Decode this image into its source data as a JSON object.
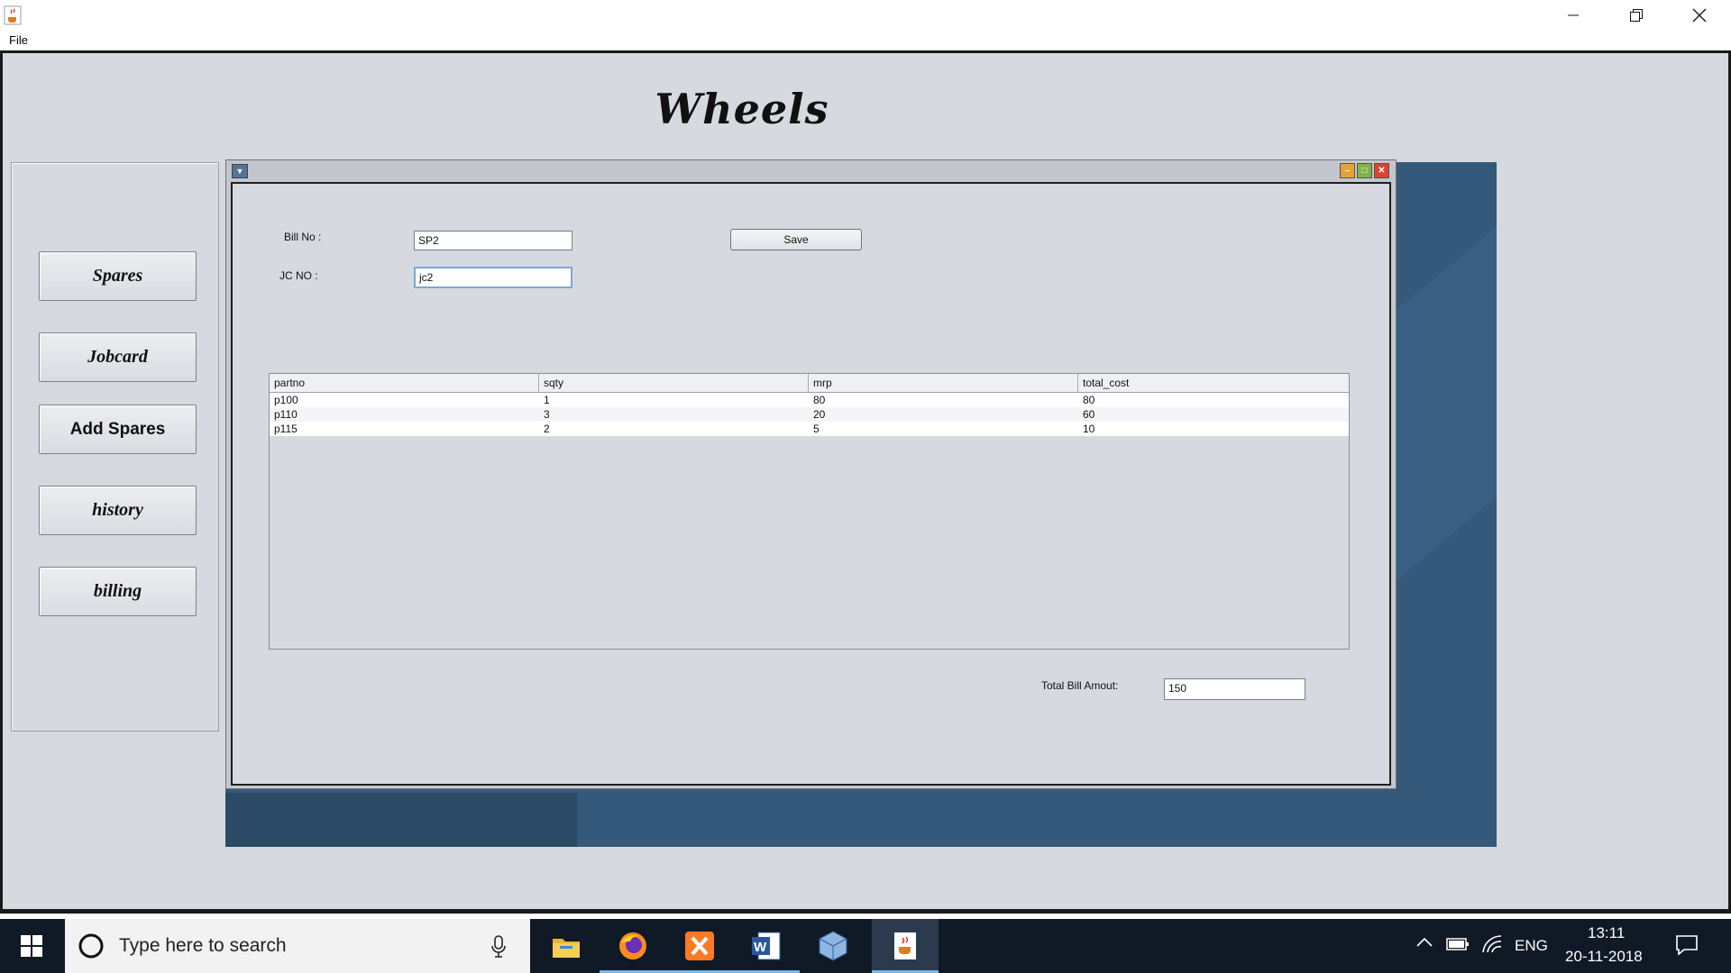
{
  "window": {
    "app_icon": "java-cup-icon",
    "controls": [
      "minimize-icon",
      "restore-icon",
      "close-icon"
    ]
  },
  "menubar": {
    "file_label": "File"
  },
  "app": {
    "title": "Wheels"
  },
  "sidebar": {
    "items": [
      {
        "label": "Spares"
      },
      {
        "label": "Jobcard"
      },
      {
        "label": "Add Spares"
      },
      {
        "label": "history"
      },
      {
        "label": "billing"
      }
    ]
  },
  "internal_frame": {
    "bill_no_label": "Bill No :",
    "bill_no_value": "SP2",
    "jc_no_label": "JC NO :",
    "jc_no_value": "jc2",
    "save_label": "Save",
    "total_label": "Total Bill Amout:",
    "total_value": "150",
    "table": {
      "columns": [
        "partno",
        "sqty",
        "mrp",
        "total_cost"
      ],
      "rows": [
        [
          "p100",
          "1",
          "80",
          "80"
        ],
        [
          "p110",
          "3",
          "20",
          "60"
        ],
        [
          "p115",
          "2",
          "5",
          "10"
        ]
      ]
    }
  },
  "taskbar": {
    "search_placeholder": "Type here to search",
    "language": "ENG",
    "time": "13:11",
    "date": "20-11-2018",
    "pinned": [
      "file-explorer-icon",
      "firefox-icon",
      "xampp-icon",
      "word-icon",
      "virtualbox-icon",
      "java-icon"
    ],
    "colors": {
      "taskbar": "#101a27",
      "active_underline": "#76b9ed"
    }
  }
}
